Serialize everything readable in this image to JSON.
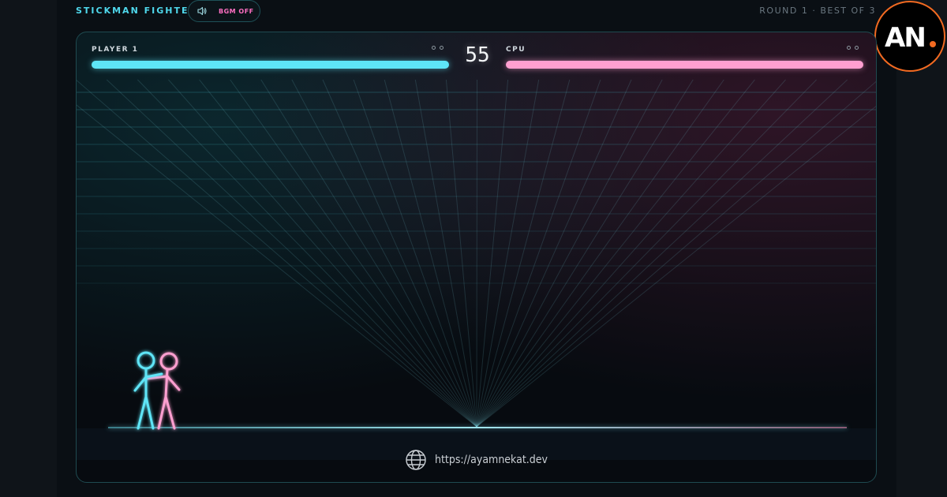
{
  "header": {
    "title": "STICKMAN FIGHTER",
    "bgm_label": "BGM OFF",
    "round_info": "ROUND 1 · BEST OF 3"
  },
  "logo": {
    "text": "AN",
    "accent_dot_color": "#f26a21"
  },
  "hud": {
    "player": {
      "name": "PLAYER 1",
      "health": 1.0,
      "rounds_won": [
        false,
        false
      ],
      "color": "#5ee5f7"
    },
    "cpu": {
      "name": "CPU",
      "health": 1.0,
      "rounds_won": [
        false,
        false
      ],
      "color": "#ff9fd0"
    },
    "timer": "55"
  },
  "footer": {
    "url": "https://ayamnekat.dev",
    "icon": "globe-icon"
  },
  "icons": {
    "bgm": "speaker-icon"
  }
}
